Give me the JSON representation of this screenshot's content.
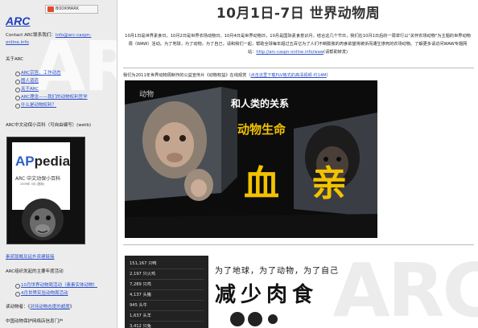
{
  "sidebar": {
    "bookmark_label": "BOOKMARK",
    "logo": "ARC",
    "contact_prefix": "Contact ARC联系我们：",
    "contact_email": "info@arc-caspn-online.info",
    "about_heading": "关于ARC",
    "about_items": [
      "ARC宗旨，工作动态",
      "图人道道",
      "关于ARC",
      "ARC理念——我们的动物权利哲学",
      "什么是动物权利？"
    ],
    "appedia_heading": "ARC中文动保小百科（可自由编写）(wetb)",
    "appedia_title_a": "AP",
    "appedia_title_b": "pedia",
    "appedia_sub": "ARC 中文动保小百科",
    "appedia_small": "2009年 3月 (更新)",
    "below_items": [
      "素贰版概及延外资建链接",
      "ARC组织发起的主要年度活动"
    ],
    "event_items": [
      "10月世界动物周活动（素素实体动物）",
      "4月世界实验动物周活动"
    ],
    "read_more_prefix": "读动物者：《",
    "read_more_link": "对待动物态度的超度",
    "read_more_suffix": "》",
    "portal": "中国动物保护网络店信息门户"
  },
  "main": {
    "title": "10月1日-7日 世界动物周",
    "intro": "10月1日是世界素食日，10月2日是世界农场动物日，10月4日是世界动物日，10月是国际素食意识月，结合这几个节日，我们在10月1日后的一周举行以\"关怀农场动物\"为主题的世界动物周（WAW）活动。为了地球，为了动物，为了自己，请和我们一起，帮助全球每年超过五百亿为了人们不断膨胀的肉食欲望将被杀而遭生惨死的农场动物。了解更多请访问WAW专题网站：",
    "intro_link": "http://arc-caspn-online.info/waw",
    "intro_suffix": "(请帮助转发)",
    "video_caption": "我们为2011年世界动物周制作的公益宣传片《动物权益》在线观赏（",
    "video_link": "点击这里下载FLV格式的高清视频 约14M",
    "video_caption_end": "）",
    "video": {
      "corner_text": "动物",
      "title1": "和人类的关系",
      "title2": "动物生命",
      "big1": "血",
      "big2": "亲"
    },
    "stats": [
      "151,167 只鸭",
      "2,197 只火鸡",
      "7,289 只鸡",
      "4,137 头猪",
      "945 头牛",
      "1,637 头羊",
      "3,412 只兔"
    ],
    "banner_line1": "为了地球，为了动物，为了自己",
    "banner_line2": "减少肉食"
  }
}
